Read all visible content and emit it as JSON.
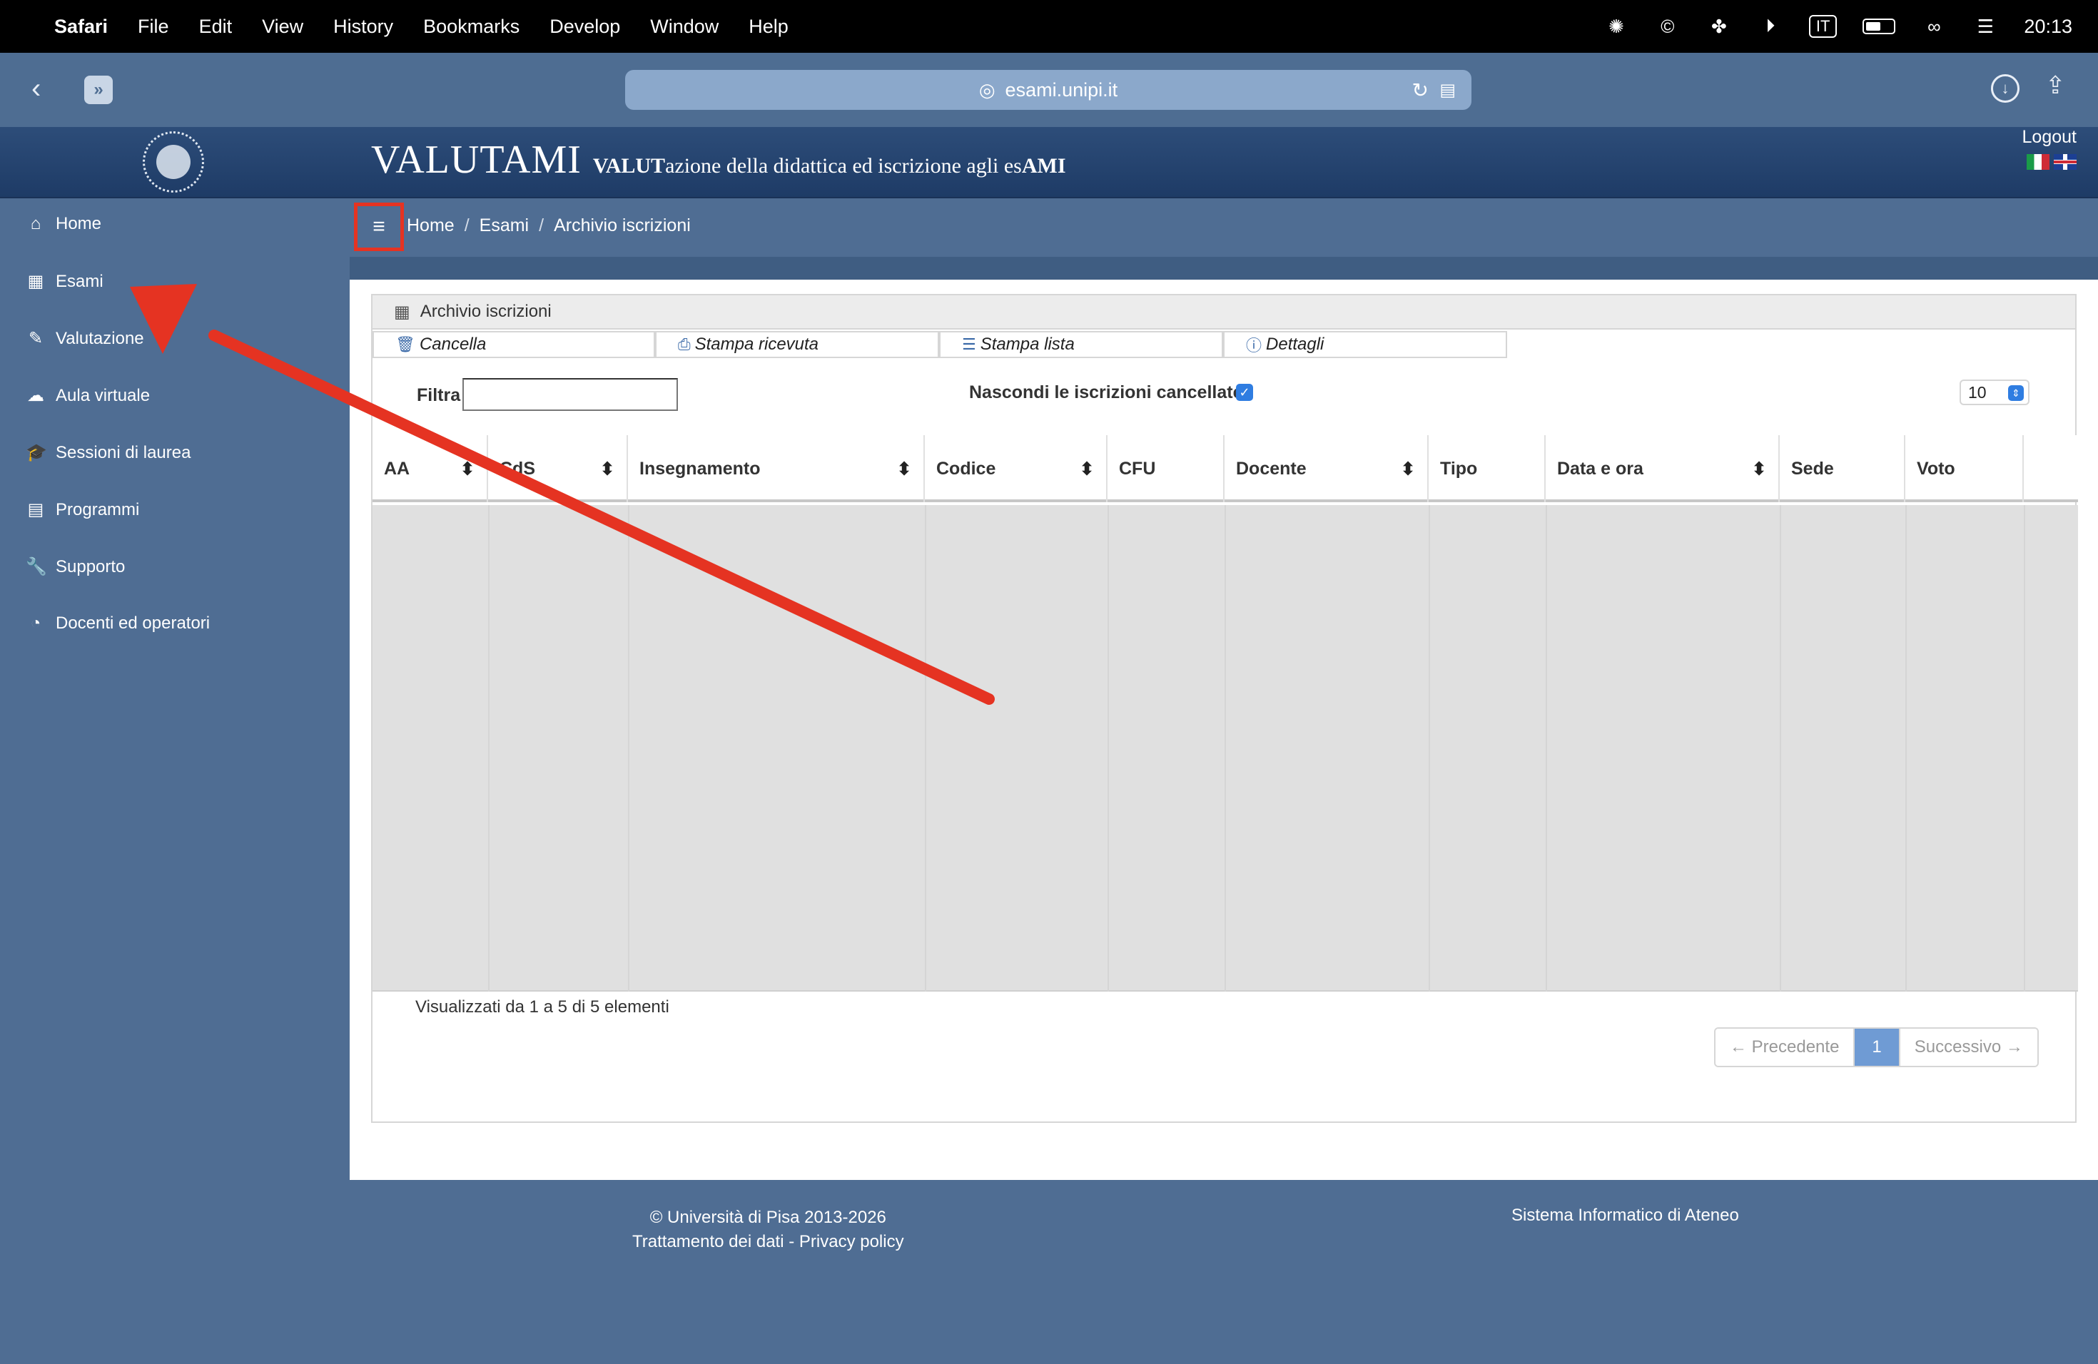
{
  "menubar": {
    "app": "Safari",
    "items": [
      "File",
      "Edit",
      "View",
      "History",
      "Bookmarks",
      "Develop",
      "Window",
      "Help"
    ],
    "input_source": "IT",
    "time": "20:13"
  },
  "browser": {
    "url": "esami.unipi.it"
  },
  "header": {
    "title_big": "VALUTAMI",
    "title_sub_1": "VALUT",
    "title_sub_2": "azione della didattica ed iscrizione agli es",
    "title_sub_3": "AMI",
    "logout": "Logout"
  },
  "sidebar": {
    "items": [
      {
        "label": "Home",
        "icon": "home-icon",
        "glyph": "⌂"
      },
      {
        "label": "Esami",
        "icon": "calendar-icon",
        "glyph": "▦"
      },
      {
        "label": "Valutazione",
        "icon": "edit-icon",
        "glyph": "✎"
      },
      {
        "label": "Aula virtuale",
        "icon": "cloud-icon",
        "glyph": "☁"
      },
      {
        "label": "Sessioni di laurea",
        "icon": "graduation-cap-icon",
        "glyph": "🎓"
      },
      {
        "label": "Programmi",
        "icon": "book-icon",
        "glyph": "▤"
      },
      {
        "label": "Supporto",
        "icon": "wrench-icon",
        "glyph": "🔧"
      },
      {
        "label": "Docenti ed operatori",
        "icon": "dashboard-icon",
        "glyph": "◔"
      }
    ]
  },
  "breadcrumb": {
    "home": "Home",
    "esami": "Esami",
    "current": "Archivio iscrizioni"
  },
  "panel": {
    "title": "Archivio iscrizioni",
    "actions": {
      "cancella": "Cancella",
      "stampa_ricevuta": "Stampa ricevuta",
      "stampa_lista": "Stampa lista",
      "dettagli": "Dettagli"
    },
    "filter_label": "Filtra",
    "filter_value": "",
    "hide_cancelled_label": "Nascondi le iscrizioni cancellate",
    "hide_cancelled_checked": true,
    "page_size": "10",
    "columns": [
      "AA",
      "CdS",
      "Insegnamento",
      "Codice",
      "CFU",
      "Docente",
      "Tipo",
      "Data e ora",
      "Sede",
      "Voto"
    ],
    "info": "Visualizzati da 1 a 5 di 5 elementi",
    "pagination": {
      "prev": "← Precedente",
      "current": "1",
      "next": "Successivo →"
    }
  },
  "footer": {
    "copyright": "© Università di Pisa 2013-2026",
    "privacy": "Trattamento dei dati - Privacy policy",
    "right": "Sistema Informatico di Ateneo"
  },
  "colors": {
    "accent": "#4f6d93",
    "header": "#1e3b66",
    "annotation": "#e53322"
  }
}
